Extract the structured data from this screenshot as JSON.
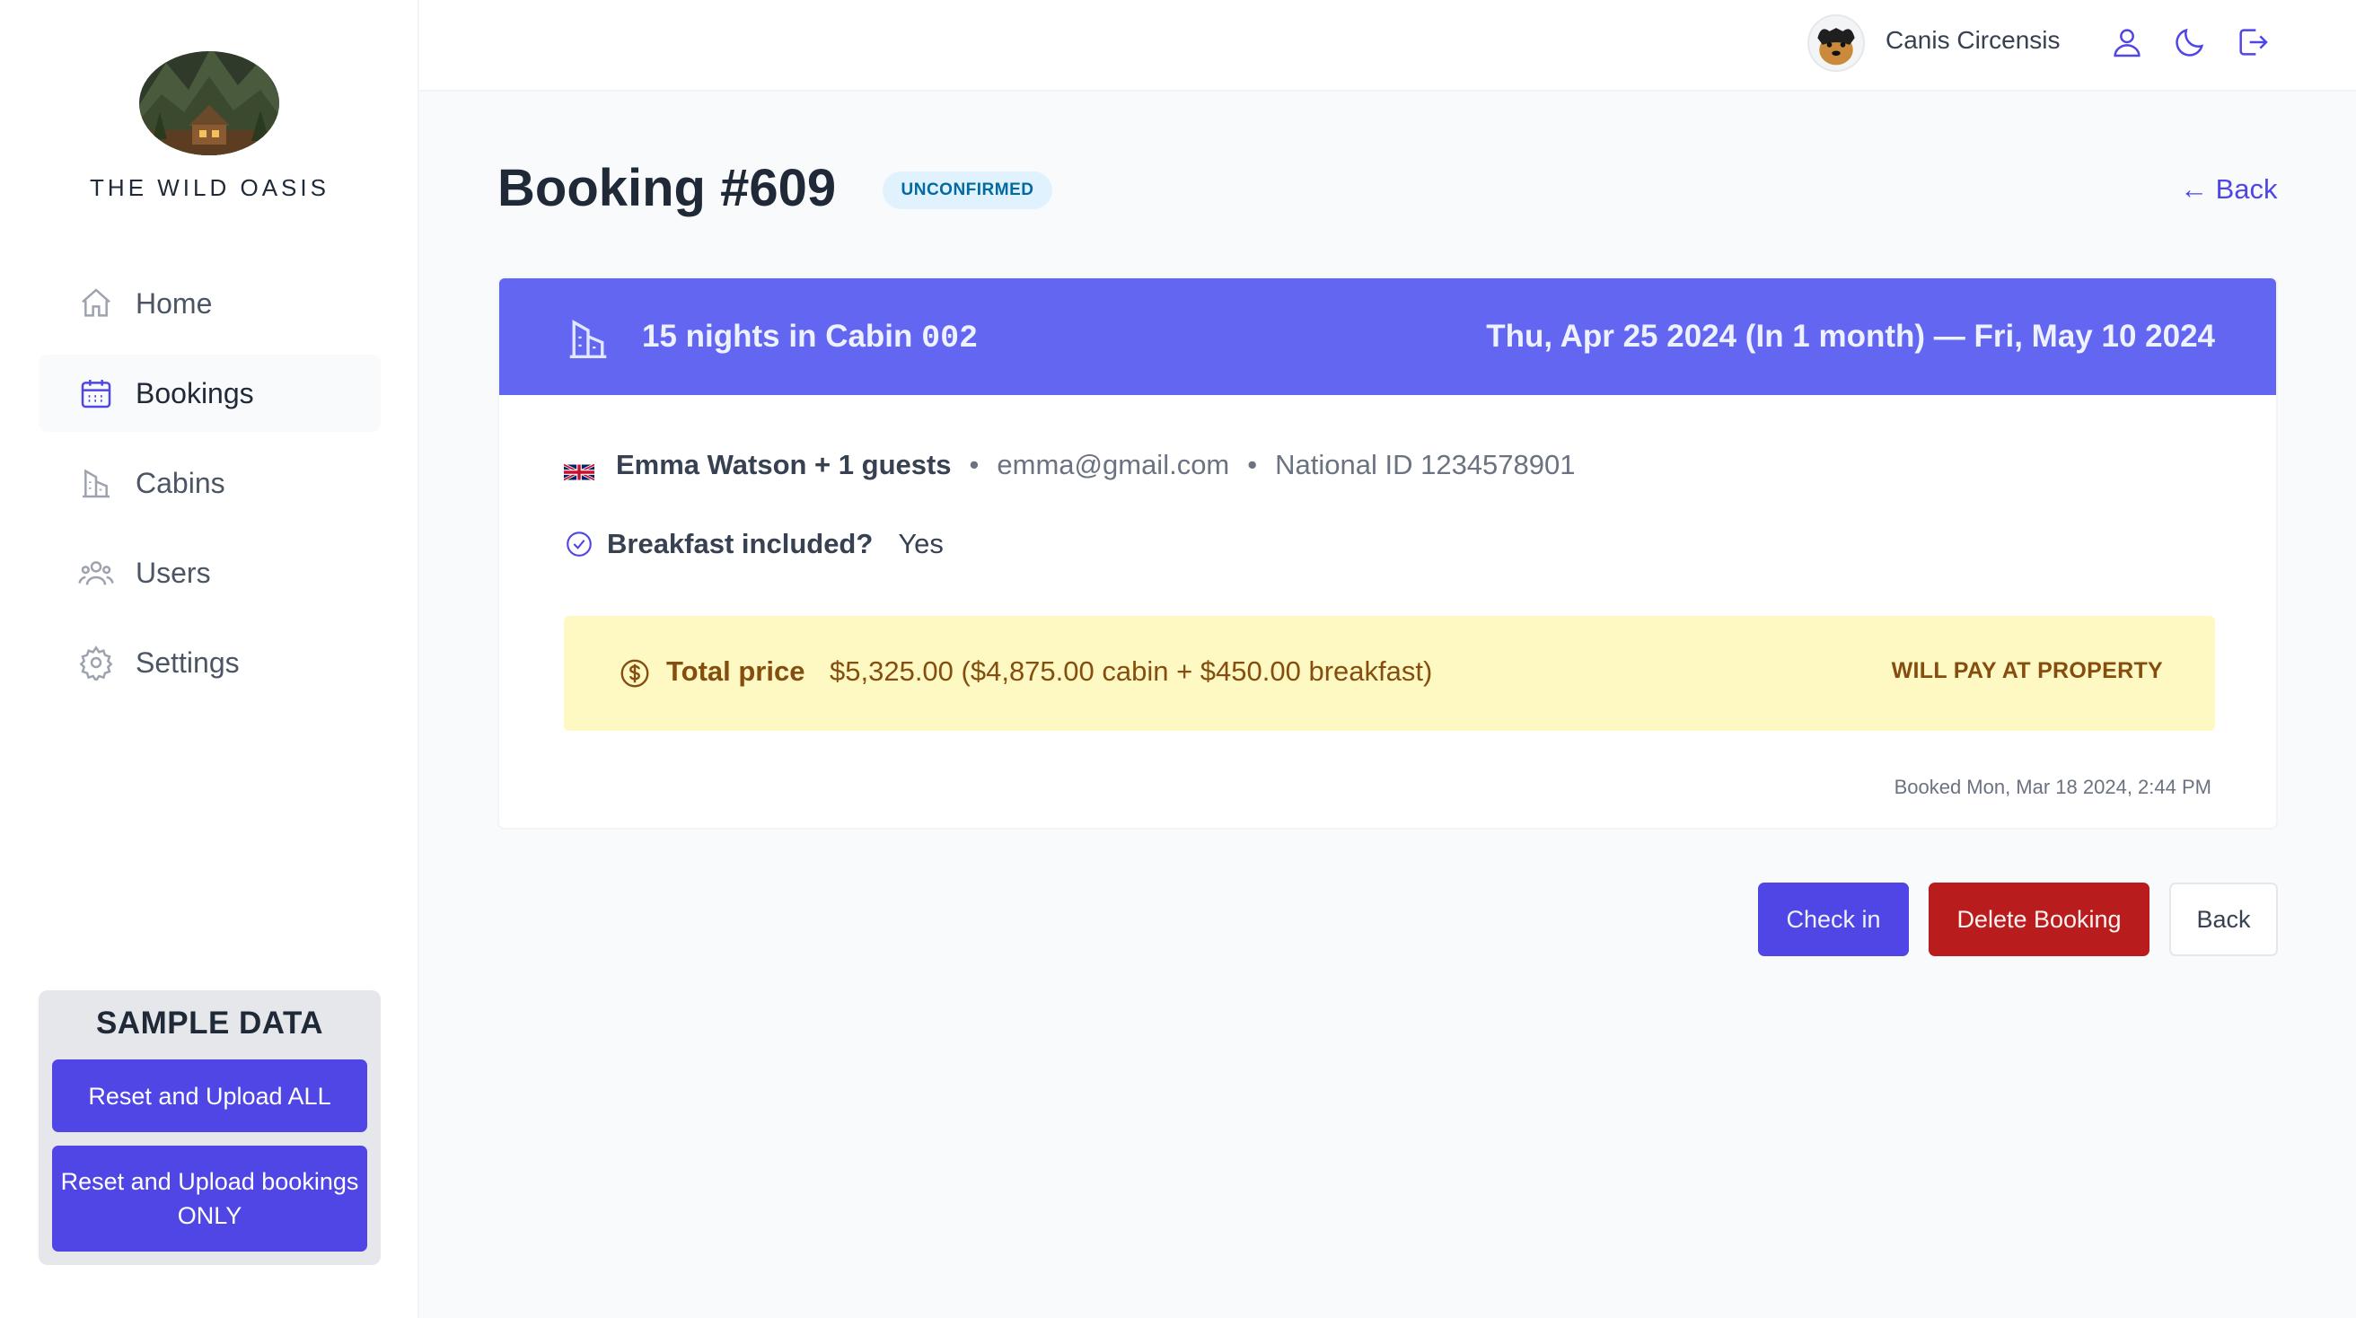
{
  "brand": {
    "name": "THE WILD OASIS"
  },
  "nav": {
    "items": [
      {
        "label": "Home",
        "icon": "home-icon"
      },
      {
        "label": "Bookings",
        "icon": "calendar-icon",
        "active": true
      },
      {
        "label": "Cabins",
        "icon": "building-icon"
      },
      {
        "label": "Users",
        "icon": "users-icon"
      },
      {
        "label": "Settings",
        "icon": "gear-icon"
      }
    ]
  },
  "sample_data": {
    "title": "SAMPLE DATA",
    "btn_all": "Reset and Upload ALL",
    "btn_bookings": "Reset and Upload bookings ONLY"
  },
  "header": {
    "username": "Canis Circensis",
    "icons": [
      "user-icon",
      "moon-icon",
      "logout-icon"
    ]
  },
  "booking": {
    "title": "Booking #609",
    "status": "UNCONFIRMED",
    "back_link": "← Back",
    "nights_text": "15 nights in Cabin",
    "cabin": "002",
    "dates": "Thu, Apr 25 2024 (In 1 month) — Fri, May 10 2024",
    "guest": "Emma Watson + 1 guests",
    "email": "emma@gmail.com",
    "national_id": "National ID 1234578901",
    "breakfast_q": "Breakfast included?",
    "breakfast_a": "Yes",
    "price_label": "Total price",
    "price_value": "$5,325.00 ($4,875.00 cabin + $450.00 breakfast)",
    "payment_status": "WILL PAY AT PROPERTY",
    "booked": "Booked Mon, Mar 18 2024, 2:44 PM"
  },
  "actions": {
    "checkin": "Check in",
    "delete": "Delete Booking",
    "back": "Back"
  },
  "colors": {
    "accent": "#4f46e5",
    "header_band": "#6366f1",
    "danger": "#b91c1c",
    "price_bg": "#fef9c3",
    "price_text": "#854d0e",
    "badge_bg": "#e0f2fe",
    "badge_text": "#0369a1"
  }
}
